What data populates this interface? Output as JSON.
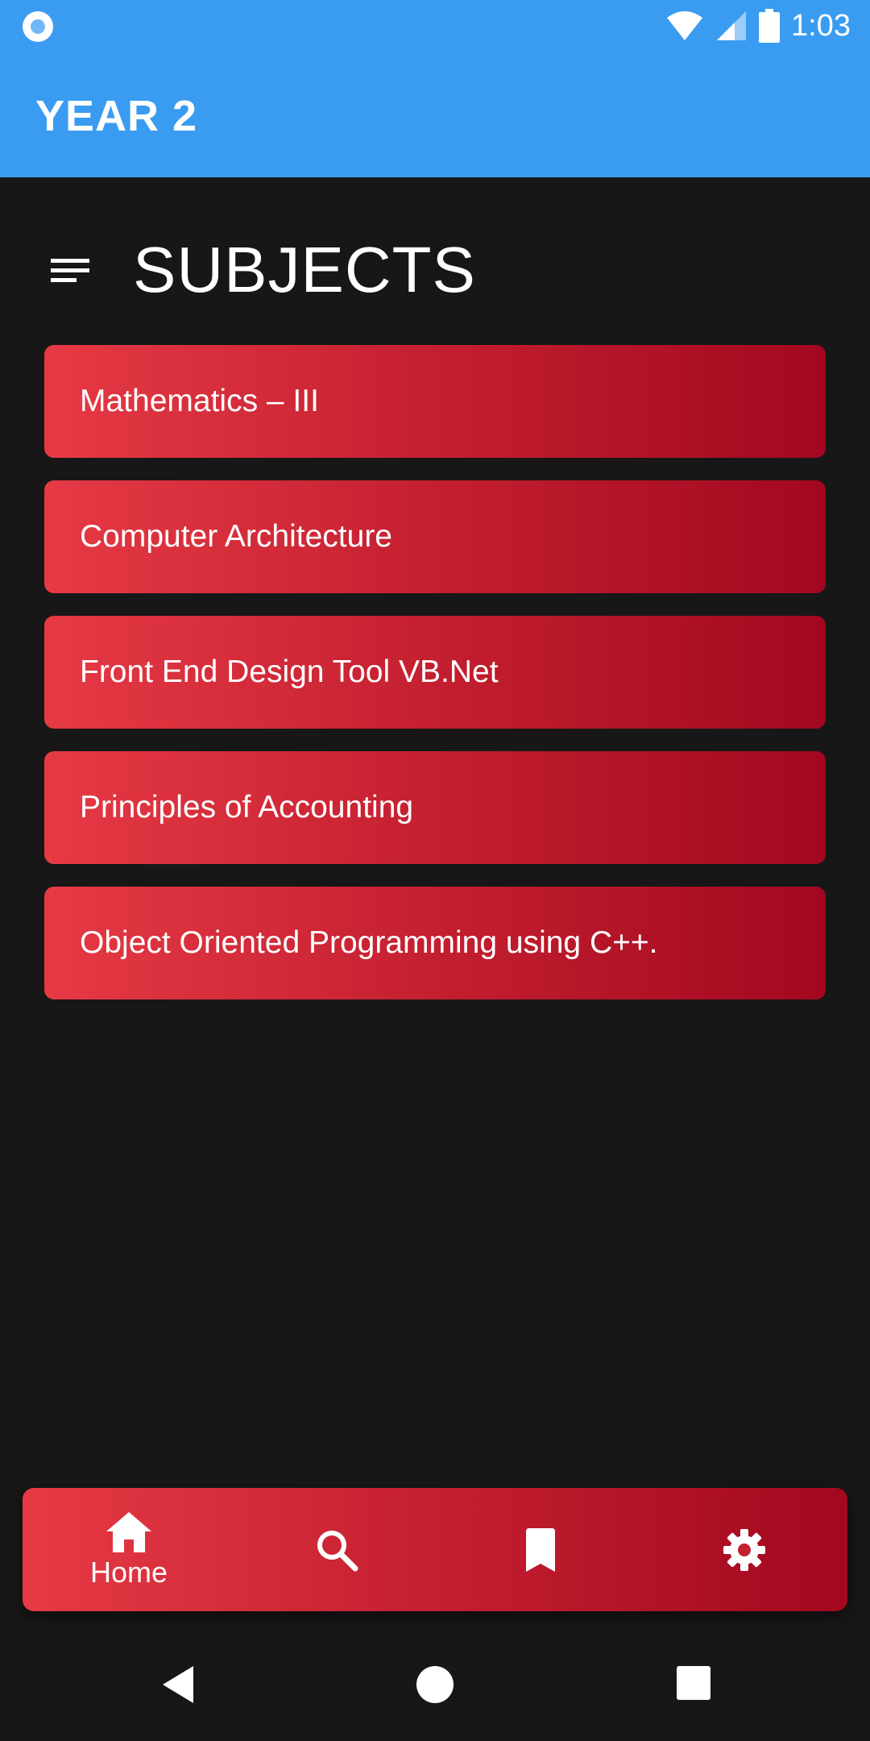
{
  "status_bar": {
    "time": "1:03",
    "icons": [
      "notification-icon",
      "wifi-icon",
      "cell-signal-icon",
      "battery-icon"
    ]
  },
  "app_bar": {
    "title": "YEAR 2",
    "color": "#3a9cf1"
  },
  "header": {
    "title": "SUBJECTS",
    "icon": "menu-icon"
  },
  "subjects": [
    {
      "label": "Mathematics – III"
    },
    {
      "label": "Computer Architecture"
    },
    {
      "label": "Front End Design Tool VB.Net"
    },
    {
      "label": "Principles of Accounting"
    },
    {
      "label": "Object Oriented Programming using C++."
    }
  ],
  "bottom_nav": {
    "items": [
      {
        "icon": "home-icon",
        "label": "Home",
        "selected": true
      },
      {
        "icon": "search-icon",
        "label": ""
      },
      {
        "icon": "bookmark-icon",
        "label": ""
      },
      {
        "icon": "gear-icon",
        "label": ""
      }
    ]
  },
  "system_nav": {
    "buttons": [
      "back-icon",
      "home-circle-icon",
      "recents-icon"
    ]
  },
  "colors": {
    "background": "#171717",
    "accent_start": "#e63a45",
    "accent_end": "#a2081f",
    "app_bar": "#3a9cf1"
  }
}
